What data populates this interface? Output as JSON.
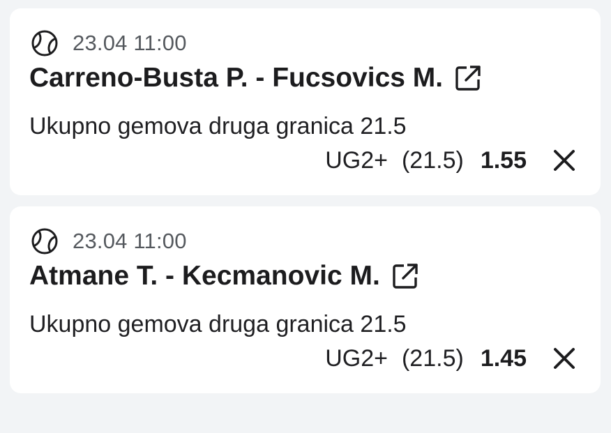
{
  "bets": [
    {
      "sport_icon": "tennis-ball-icon",
      "datetime": "23.04 11:00",
      "match": "Carreno-Busta P. - Fucsovics M.",
      "market": "Ukupno gemova druga granica 21.5",
      "pick": "UG2+",
      "line": "(21.5)",
      "odds": "1.55"
    },
    {
      "sport_icon": "tennis-ball-icon",
      "datetime": "23.04 11:00",
      "match": "Atmane T. - Kecmanovic M.",
      "market": "Ukupno gemova druga granica 21.5",
      "pick": "UG2+",
      "line": "(21.5)",
      "odds": "1.45"
    }
  ],
  "colors": {
    "background": "#f2f4f6",
    "card": "#ffffff",
    "text": "#1c1c1e",
    "muted": "#55595e"
  }
}
